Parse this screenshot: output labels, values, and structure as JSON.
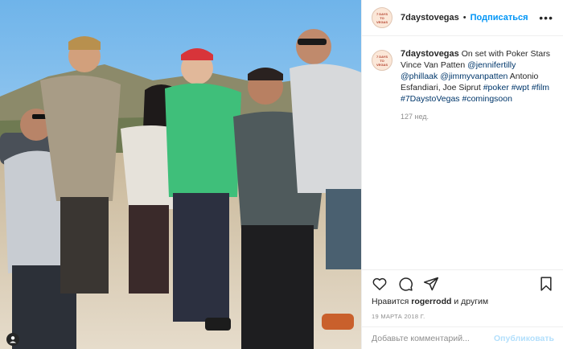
{
  "post": {
    "username": "7daystovegas",
    "follow_label": "Подписаться",
    "avatar_text": "7 DAYS TO VEGAS",
    "more_label": "•••",
    "caption_parts": [
      {
        "text": "On set with Poker Stars Vince Van Patten ",
        "type": "text"
      },
      {
        "text": "@jennifertilly",
        "type": "tag"
      },
      {
        "text": " ",
        "type": "text"
      },
      {
        "text": "@phillaak",
        "type": "tag"
      },
      {
        "text": " ",
        "type": "text"
      },
      {
        "text": "@jimmyvanpatten",
        "type": "tag"
      },
      {
        "text": " Antonio Esfandiari, Joe Siprut ",
        "type": "text"
      },
      {
        "text": "#poker",
        "type": "tag"
      },
      {
        "text": " ",
        "type": "text"
      },
      {
        "text": "#wpt",
        "type": "tag"
      },
      {
        "text": " ",
        "type": "text"
      },
      {
        "text": "#film",
        "type": "tag"
      },
      {
        "text": " ",
        "type": "text"
      },
      {
        "text": "#7DaystoVegas",
        "type": "tag"
      },
      {
        "text": " ",
        "type": "text"
      },
      {
        "text": "#comingsoon",
        "type": "tag"
      }
    ],
    "age": "127 нед.",
    "likes_prefix": "Нравится ",
    "likes_user": "rogerrodd",
    "likes_suffix": " и другим",
    "date": "19 МАРТА 2018 Г.",
    "comment_placeholder": "Добавьте комментарий...",
    "publish_label": "Опубликовать"
  },
  "icons": [
    "heart-icon",
    "comment-icon",
    "share-icon",
    "bookmark-icon",
    "more-icon",
    "profile-icon"
  ],
  "colors": {
    "accent": "#0095f6",
    "tag": "#00376b",
    "muted": "#8e8e8e",
    "publish_disabled": "#b2dffc"
  }
}
